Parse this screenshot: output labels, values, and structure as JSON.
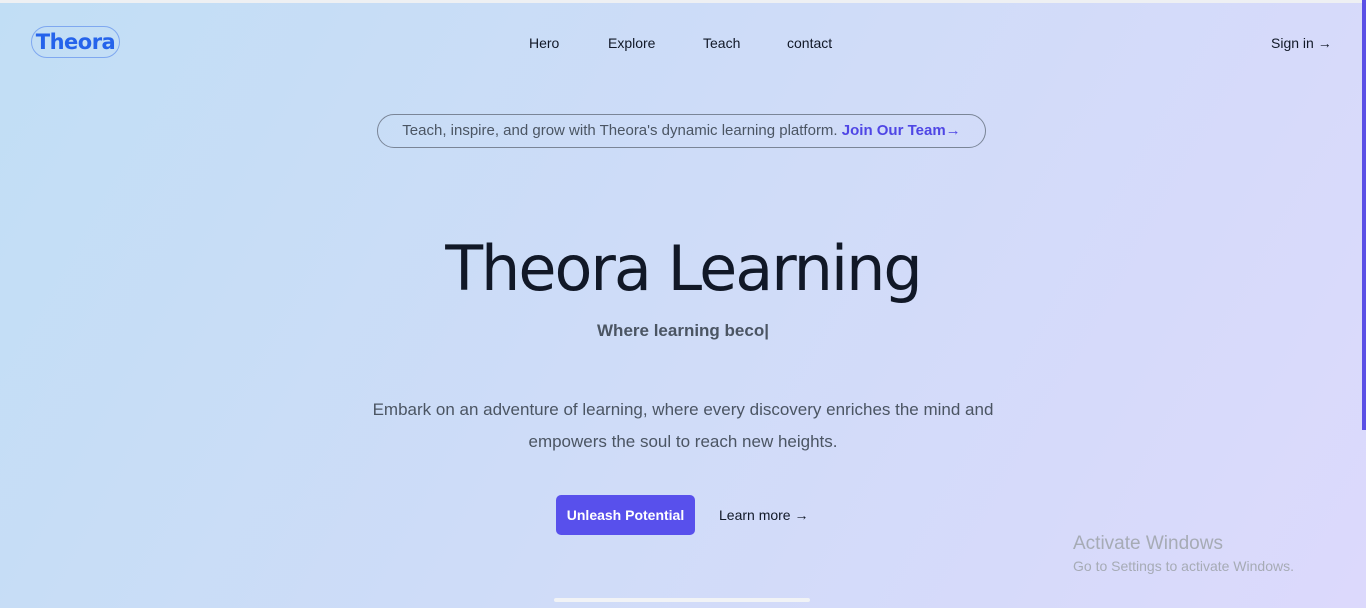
{
  "logo": "Theora",
  "nav": [
    "Hero",
    "Explore",
    "Teach",
    "contact"
  ],
  "sign_in": "Sign in →",
  "banner": {
    "text": "Teach, inspire, and grow with Theora's dynamic learning platform. ",
    "link": "Join Our Team→"
  },
  "hero": {
    "title": "Theora Learning",
    "typing": "Where learning beco|",
    "description": "Embark on an adventure of learning, where every discovery enriches the mind and empowers the soul to reach new heights.",
    "primary_button": "Unleash Potential",
    "secondary_link": "Learn more →"
  },
  "watermark": {
    "title": "Activate Windows",
    "subtitle": "Go to Settings to activate Windows."
  },
  "colors": {
    "accent": "#5850ec",
    "logo": "#2563eb"
  }
}
